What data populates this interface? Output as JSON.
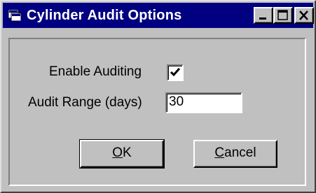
{
  "window": {
    "title": "Cylinder Audit Options",
    "titlebar_color": "#000080",
    "face_color": "#c0c0c0",
    "icons": {
      "app": "app-window-icon",
      "minimize": "minimize-icon",
      "maximize": "maximize-icon",
      "close": "close-icon"
    }
  },
  "form": {
    "enable_auditing": {
      "label": "Enable Auditing",
      "checked": true
    },
    "audit_range": {
      "label": "Audit Range (days)",
      "value": "30"
    }
  },
  "buttons": {
    "ok": {
      "mnemonic": "O",
      "rest": "K"
    },
    "cancel": {
      "mnemonic": "C",
      "rest": "ancel"
    }
  }
}
